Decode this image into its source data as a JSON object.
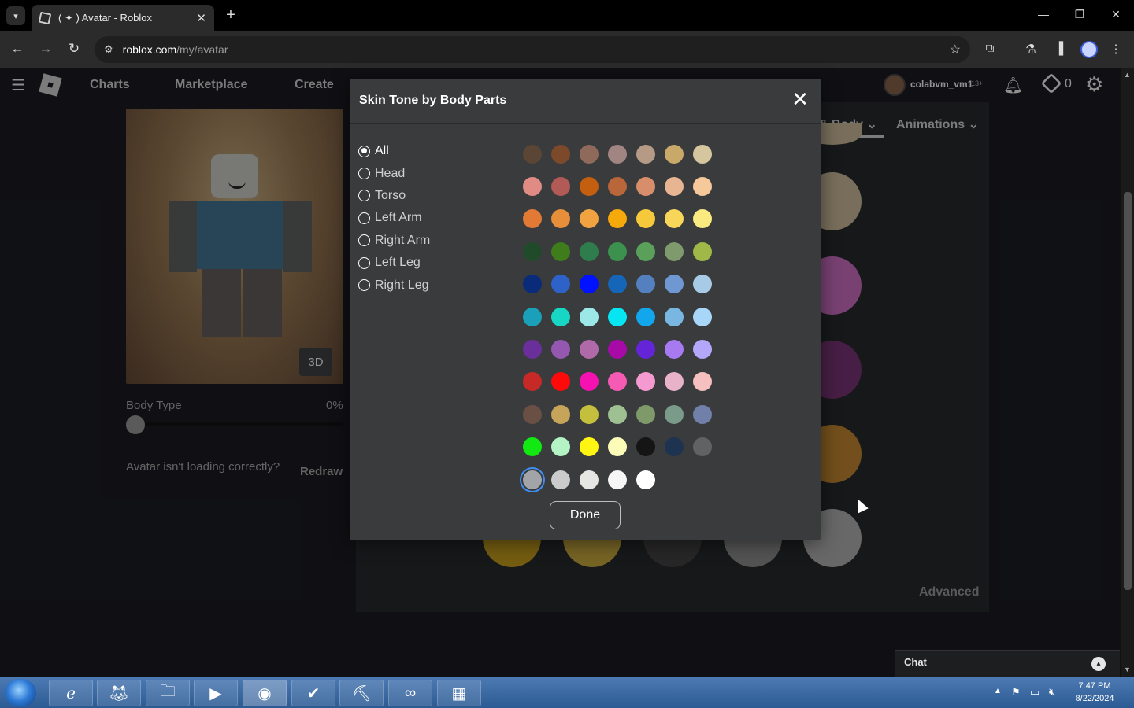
{
  "browser": {
    "tab_title": "( ✦ ) Avatar - Roblox",
    "tab_close": "✕",
    "new_tab": "+",
    "url_host": "roblox.com",
    "url_path": "/my/avatar"
  },
  "nav": {
    "links": [
      "Charts",
      "Marketplace",
      "Create"
    ],
    "username": "colabvm_vm1",
    "age_badge": "13+",
    "robux": "0"
  },
  "avatar": {
    "view_mode": "3D",
    "body_type_label": "Body Type",
    "body_type_value": "0%",
    "body_type_fraction": 0,
    "loading_text": "Avatar isn't loading correctly?",
    "redraw": "Redraw"
  },
  "panel": {
    "tab_body": "& Body",
    "tab_animations": "Animations",
    "advanced": "Advanced",
    "chevron": "⌄",
    "bg_swatches": [
      "#b8a98d",
      "#b864b0",
      "#6e2f6a",
      "#b07a2c",
      "#a0a0a0",
      "#b38f1b",
      "#b69a3a",
      "#3c3d3e",
      "#808080"
    ]
  },
  "chat": {
    "label": "Chat"
  },
  "modal": {
    "title": "Skin Tone by Body Parts",
    "close": "✕",
    "body_parts": [
      "All",
      "Head",
      "Torso",
      "Left Arm",
      "Right Arm",
      "Left Leg",
      "Right Leg"
    ],
    "selected_part": "All",
    "swatch_rows": [
      [
        "#5b4535",
        "#7c4a2a",
        "#8f6a5a",
        "#a08582",
        "#b59a86",
        "#c9a96a",
        "#d6c6a0"
      ],
      [
        "#e08c85",
        "#b25a55",
        "#c45f10",
        "#b8663a",
        "#d88e6a",
        "#e8b593",
        "#f5c99a"
      ],
      [
        "#e27935",
        "#e78e3a",
        "#f0a340",
        "#f6a90b",
        "#f6c93c",
        "#f8d65a",
        "#faea80"
      ],
      [
        "#214a2a",
        "#3f7d1c",
        "#2f7d4d",
        "#3c914f",
        "#5aa05a",
        "#7f9a6c",
        "#a0b848"
      ],
      [
        "#0a2a7a",
        "#2f62c8",
        "#0012ff",
        "#1565b8",
        "#5580c0",
        "#6f98d2",
        "#a7cbe6"
      ],
      [
        "#1aa0b8",
        "#18d6c4",
        "#9ce8e8",
        "#06e6f2",
        "#12a6ec",
        "#7ab6e2",
        "#a8d6f8"
      ],
      [
        "#6a2f9a",
        "#9458b0",
        "#b06aaa",
        "#a80aa8",
        "#6425d8",
        "#a87af2",
        "#b4a6f8"
      ],
      [
        "#c72a26",
        "#ff0a0a",
        "#f512b0",
        "#f55ab4",
        "#f59ad0",
        "#e8b2c8",
        "#f7c0c0"
      ],
      [
        "#6a4f45",
        "#c6a45a",
        "#c4c03e",
        "#9ec092",
        "#7f9a6a",
        "#7a9a8a",
        "#7080a8"
      ],
      [
        "#12e812",
        "#b4f4c4",
        "#fff512",
        "#fcfcb8",
        "#151515",
        "#1d3350",
        "#606264"
      ],
      [
        "#a2a4a8",
        "#cbcbcb",
        "#e6e6e2",
        "#f6f6f6",
        "#ffffff"
      ]
    ],
    "selected_swatch": "#a2a4a8",
    "done": "Done"
  },
  "taskbar": {
    "time": "7:47 PM",
    "date": "8/22/2024"
  }
}
